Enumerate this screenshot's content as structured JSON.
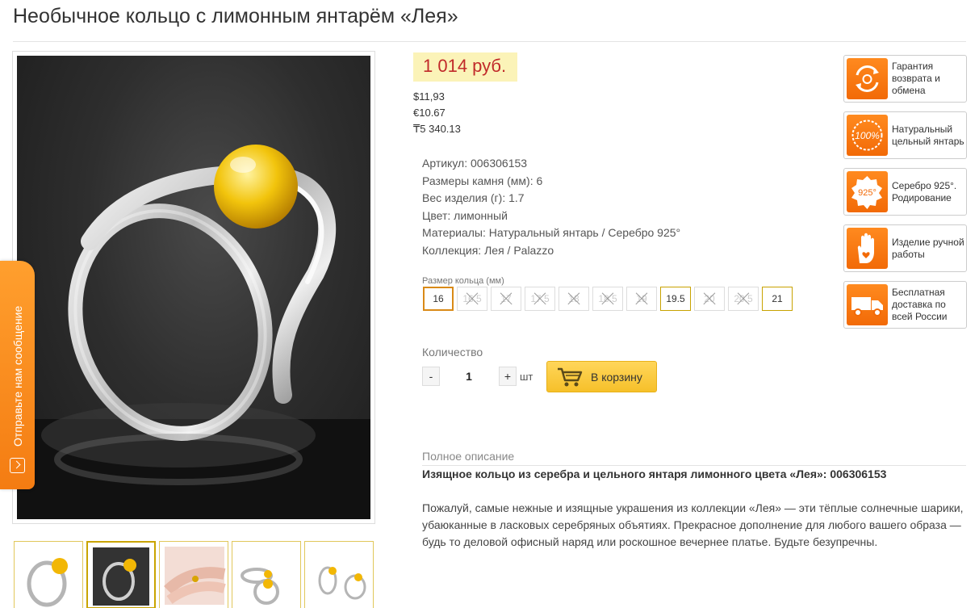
{
  "product": {
    "title": "Необычное кольцо с лимонным янтарём «Лея»",
    "price": "1 014 руб.",
    "alt_prices": [
      "$11,93",
      "€10.67",
      "₸5 340.13"
    ],
    "specs": [
      {
        "label": "Артикул:",
        "value": "006306153"
      },
      {
        "label": "Размеры камня (мм):",
        "value": "6"
      },
      {
        "label": "Вес изделия (г):",
        "value": "1.7"
      },
      {
        "label": "Цвет:",
        "value": "лимонный"
      },
      {
        "label": "Материалы:",
        "value": "Натуральный янтарь / Серебро 925°"
      },
      {
        "label": "Коллекция:",
        "value": "Лея / Palazzo"
      }
    ]
  },
  "sizes": {
    "caption": "Размер кольца (мм)",
    "options": [
      {
        "label": "16",
        "state": "selected"
      },
      {
        "label": "16.5",
        "state": "disabled"
      },
      {
        "label": "17",
        "state": "disabled"
      },
      {
        "label": "17.5",
        "state": "disabled"
      },
      {
        "label": "18",
        "state": "disabled"
      },
      {
        "label": "18.5",
        "state": "disabled"
      },
      {
        "label": "19",
        "state": "disabled"
      },
      {
        "label": "19.5",
        "state": "available"
      },
      {
        "label": "20",
        "state": "disabled"
      },
      {
        "label": "20.5",
        "state": "disabled"
      },
      {
        "label": "21",
        "state": "available"
      }
    ]
  },
  "quantity": {
    "label": "Количество",
    "minus": "-",
    "plus": "+",
    "value": "1",
    "unit": "шт"
  },
  "cart": {
    "label": "В корзину",
    "icon": "cart-icon"
  },
  "features": [
    {
      "text": "Гарантия возврата и обмена",
      "icon": "return-guarantee-icon"
    },
    {
      "text": "Натуральный цельный янтарь",
      "icon": "natural-amber-icon",
      "badge_text": "100%"
    },
    {
      "text": "Серебро 925°. Родирование",
      "icon": "silver-925-icon",
      "badge_text": "925°"
    },
    {
      "text": "Изделие ручной работы",
      "icon": "handmade-icon"
    },
    {
      "text": "Бесплатная доставка по всей России",
      "icon": "free-delivery-icon"
    }
  ],
  "side_tab": {
    "label": "Отправьте нам сообщение"
  },
  "description": {
    "caption": "Полное описание",
    "heading": "Изящное кольцо из серебра и цельного янтаря лимонного цвета «Лея»: 006306153",
    "body": "Пожалуй, самые нежные и изящные украшения из коллекции «Лея» — эти тёплые солнечные шарики, убаюканные в ласковых серебряных объятиях. Прекрасное дополнение для любого вашего образа — будь то деловой офисный наряд или роскошное вечернее платье. Будьте безупречны."
  },
  "colors": {
    "price_text": "#c12a2a",
    "price_bg": "#fbf3b8",
    "accent_orange": "#f47c12",
    "cart_button": "#f6c02a",
    "amber": "#f2b705"
  }
}
